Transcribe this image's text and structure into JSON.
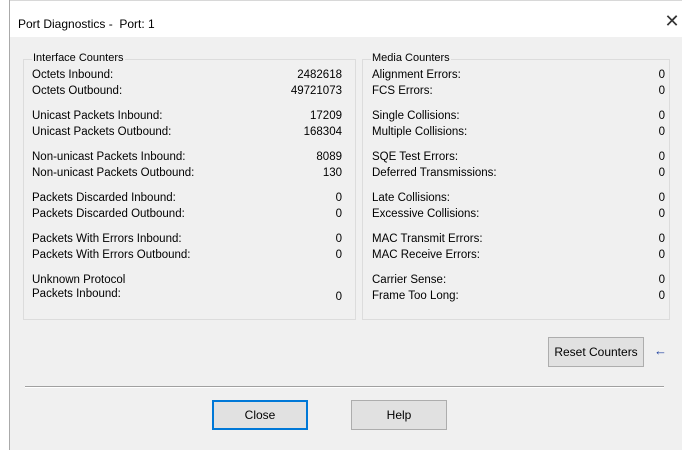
{
  "window": {
    "title": "Port Diagnostics -  Port: 1",
    "close_glyph": "✕"
  },
  "interface_counters": {
    "legend": "Interface Counters",
    "rows": [
      {
        "label": "Octets Inbound:",
        "value": "2482618"
      },
      {
        "label": "Octets Outbound:",
        "value": "49721073"
      },
      {
        "label": "Unicast Packets Inbound:",
        "value": "17209"
      },
      {
        "label": "Unicast Packets Outbound:",
        "value": "168304"
      },
      {
        "label": "Non-unicast Packets Inbound:",
        "value": "8089"
      },
      {
        "label": "Non-unicast Packets Outbound:",
        "value": "130"
      },
      {
        "label": "Packets Discarded Inbound:",
        "value": "0"
      },
      {
        "label": "Packets Discarded Outbound:",
        "value": "0"
      },
      {
        "label": "Packets With Errors Inbound:",
        "value": "0"
      },
      {
        "label": "Packets With Errors Outbound:",
        "value": "0"
      },
      {
        "label": "Unknown Protocol",
        "value": ""
      },
      {
        "label": "Packets Inbound:",
        "value": "0"
      }
    ]
  },
  "media_counters": {
    "legend": "Media Counters",
    "rows": [
      {
        "label": "Alignment Errors:",
        "value": "0"
      },
      {
        "label": "FCS Errors:",
        "value": "0"
      },
      {
        "label": "Single Collisions:",
        "value": "0"
      },
      {
        "label": "Multiple Collisions:",
        "value": "0"
      },
      {
        "label": "SQE Test Errors:",
        "value": "0"
      },
      {
        "label": "Deferred Transmissions:",
        "value": "0"
      },
      {
        "label": "Late Collisions:",
        "value": "0"
      },
      {
        "label": "Excessive Collisions:",
        "value": "0"
      },
      {
        "label": "MAC Transmit Errors:",
        "value": "0"
      },
      {
        "label": "MAC Receive Errors:",
        "value": "0"
      },
      {
        "label": "Carrier Sense:",
        "value": "0"
      },
      {
        "label": "Frame Too Long:",
        "value": "0"
      }
    ]
  },
  "buttons": {
    "reset": "Reset Counters",
    "close": "Close",
    "help": "Help",
    "arrow_glyph": "←"
  }
}
